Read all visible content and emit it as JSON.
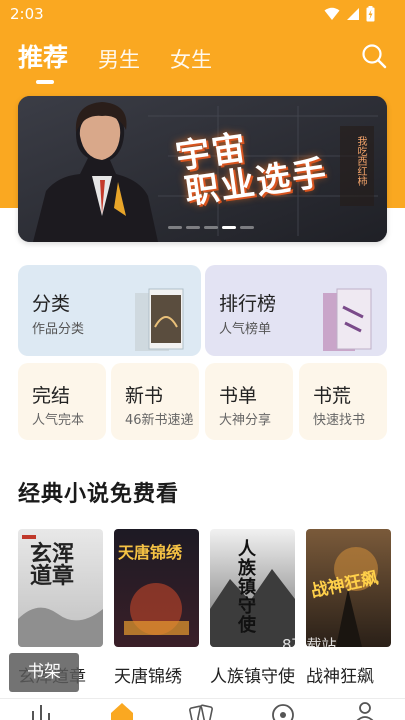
{
  "status": {
    "time": "2:03"
  },
  "nav": {
    "tabs": [
      {
        "label": "推荐",
        "active": true
      },
      {
        "label": "男生",
        "active": false
      },
      {
        "label": "女生",
        "active": false
      }
    ]
  },
  "banner": {
    "title_line1": "宇宙",
    "title_line2": "职业选手",
    "author": "我吃西红柿",
    "slide_count": 5,
    "active_slide": 3
  },
  "entries": {
    "category": {
      "title": "分类",
      "subtitle": "作品分类"
    },
    "ranking": {
      "title": "排行榜",
      "subtitle": "人气榜单"
    },
    "finished": {
      "title": "完结",
      "subtitle": "人气完本"
    },
    "new_books": {
      "title": "新书",
      "subtitle": "46新书速递"
    },
    "booklist": {
      "title": "书单",
      "subtitle": "大神分享"
    },
    "book_hunt": {
      "title": "书荒",
      "subtitle": "快速找书"
    }
  },
  "section": {
    "title": "经典小说免费看"
  },
  "books": [
    {
      "name": "玄浑道章",
      "cover_text": "玄浑道章"
    },
    {
      "name": "天唐锦绣",
      "cover_text": "天唐锦绣"
    },
    {
      "name": "人族镇守使",
      "cover_text": "人族镇守使"
    },
    {
      "name": "战神狂飙",
      "cover_text": "战神狂飙"
    }
  ],
  "overlay": {
    "shelf_label": "书架",
    "watermark": "8下载站"
  },
  "colors": {
    "brand": "#FAA821",
    "banner_bg": "#2f3038"
  },
  "bottom_nav": {
    "icons": [
      "chart-icon",
      "home-icon",
      "cards-icon",
      "discover-icon",
      "profile-icon"
    ]
  }
}
